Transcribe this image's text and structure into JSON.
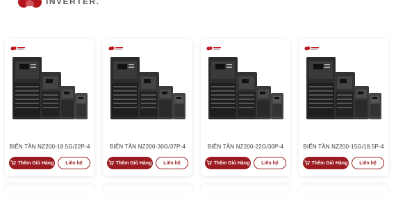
{
  "brand": {
    "text": "INVERTER."
  },
  "products": [
    {
      "title": "BIẾN TẦN NZ200-18.5G/22P-4",
      "cart_label": "Thêm Giỏ Hàng",
      "contact_label": "Liên hệ"
    },
    {
      "title": "BIẾN TẦN NZ200-30G/37P-4",
      "cart_label": "Thêm Giỏ Hàng",
      "contact_label": "Liên hệ"
    },
    {
      "title": "BIẾN TẦN NZ200-22G/30P-4",
      "cart_label": "Thêm Giỏ Hàng",
      "contact_label": "Liên hệ"
    },
    {
      "title": "BIẾN TẦN NZ200-15G/18.5P-4",
      "cart_label": "Thêm Giỏ Hàng",
      "contact_label": "Liên hệ"
    }
  ],
  "colors": {
    "accent": "#9b1b20",
    "text": "#333333"
  },
  "icons": {
    "cart": "cart-icon",
    "logo": "brand-logo"
  }
}
